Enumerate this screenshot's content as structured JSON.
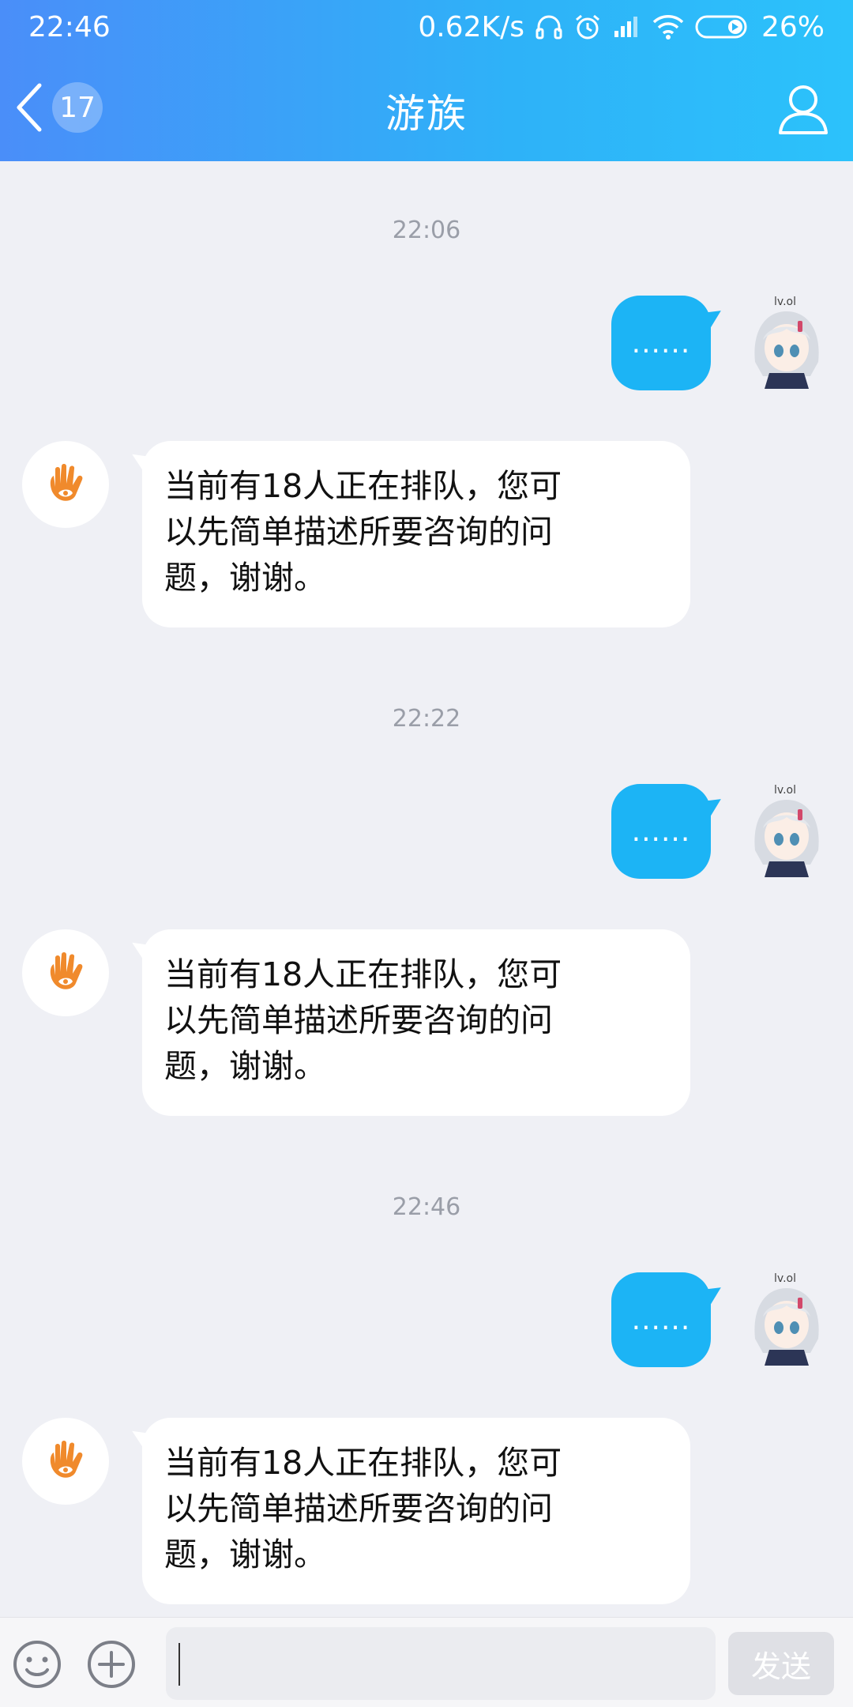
{
  "status_bar": {
    "time": "22:46",
    "network_speed": "0.62K/s",
    "battery": "26%",
    "icons": [
      "headphones-icon",
      "alarm-icon",
      "signal-icon",
      "wifi-icon",
      "battery-icon"
    ]
  },
  "nav": {
    "back_icon": "chevron-left-icon",
    "unread_count": "17",
    "title": "游族",
    "profile_icon": "person-icon"
  },
  "messages": [
    {
      "timestamp": "22:06",
      "me_text": "......",
      "bot_text": "当前有18人正在排队，您可\n以先简单描述所要咨询的问\n题，谢谢。"
    },
    {
      "timestamp": "22:22",
      "me_text": "......",
      "bot_text": "当前有18人正在排队，您可\n以先简单描述所要咨询的问\n题，谢谢。"
    },
    {
      "timestamp": "22:46",
      "me_text": "......",
      "bot_text": "当前有18人正在排队，您可\n以先简单描述所要咨询的问\n题，谢谢。"
    }
  ],
  "avatar_me_label": "lv.ol",
  "input_bar": {
    "emoji_icon": "emoji-icon",
    "plus_icon": "plus-circle-icon",
    "input_value": "",
    "send_label": "发送"
  },
  "colors": {
    "header_start": "#4a8ef9",
    "header_end": "#2cc2fb",
    "my_bubble": "#1cb4f5",
    "bot_logo": "#f08a2c",
    "background": "#eff0f5"
  }
}
